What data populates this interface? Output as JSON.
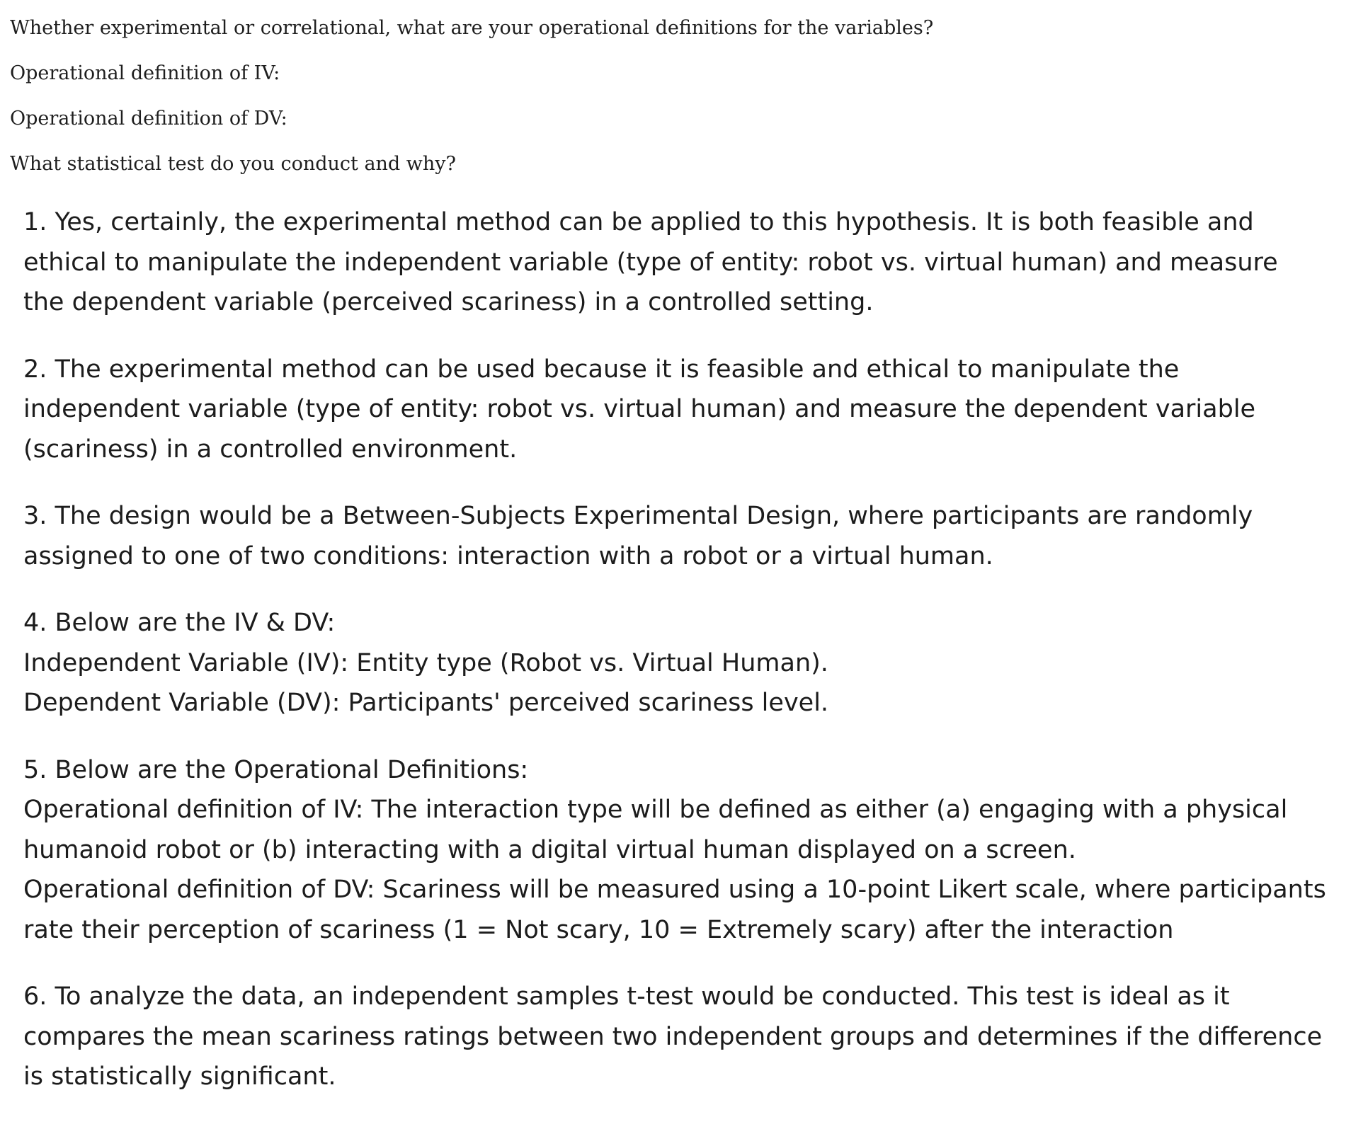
{
  "questions": [
    "Whether experimental or correlational, what are your operational definitions for the variables?",
    "Operational definition of IV:",
    "Operational definition of DV:",
    "What statistical test do you conduct and why?"
  ],
  "answers": {
    "a1": "1. Yes, certainly, the experimental method can be applied to this hypothesis. It is both feasible and ethical to manipulate the independent variable (type of entity: robot vs. virtual human) and measure the dependent variable (perceived scariness) in a controlled setting.",
    "a2": "2. The experimental method can be used because it is feasible and ethical to manipulate the independent variable (type of entity: robot vs. virtual human) and measure the dependent variable (scariness) in a controlled environment.",
    "a3": "3. The design would be a Between-Subjects Experimental Design, where participants are randomly assigned to one of two conditions: interaction with a robot or a virtual human.",
    "a4": {
      "heading": "4. Below are the IV & DV:",
      "iv": "Independent Variable (IV): Entity type (Robot vs. Virtual Human).",
      "dv": "Dependent Variable (DV): Participants' perceived scariness level."
    },
    "a5": {
      "heading": "5. Below are the Operational Definitions:",
      "iv": "Operational definition of IV: The interaction type will be defined as either (a) engaging with a physical humanoid robot or (b) interacting with a digital virtual human displayed on a screen.",
      "dv": "Operational definition of DV: Scariness will be measured using a 10-point Likert scale, where participants rate their perception of scariness (1 = Not scary, 10 = Extremely scary) after the interaction"
    },
    "a6": "6. To analyze the data, an independent samples t-test would be conducted. This test is ideal as it compares the mean scariness ratings between two independent groups and determines if the difference is statistically significant."
  }
}
